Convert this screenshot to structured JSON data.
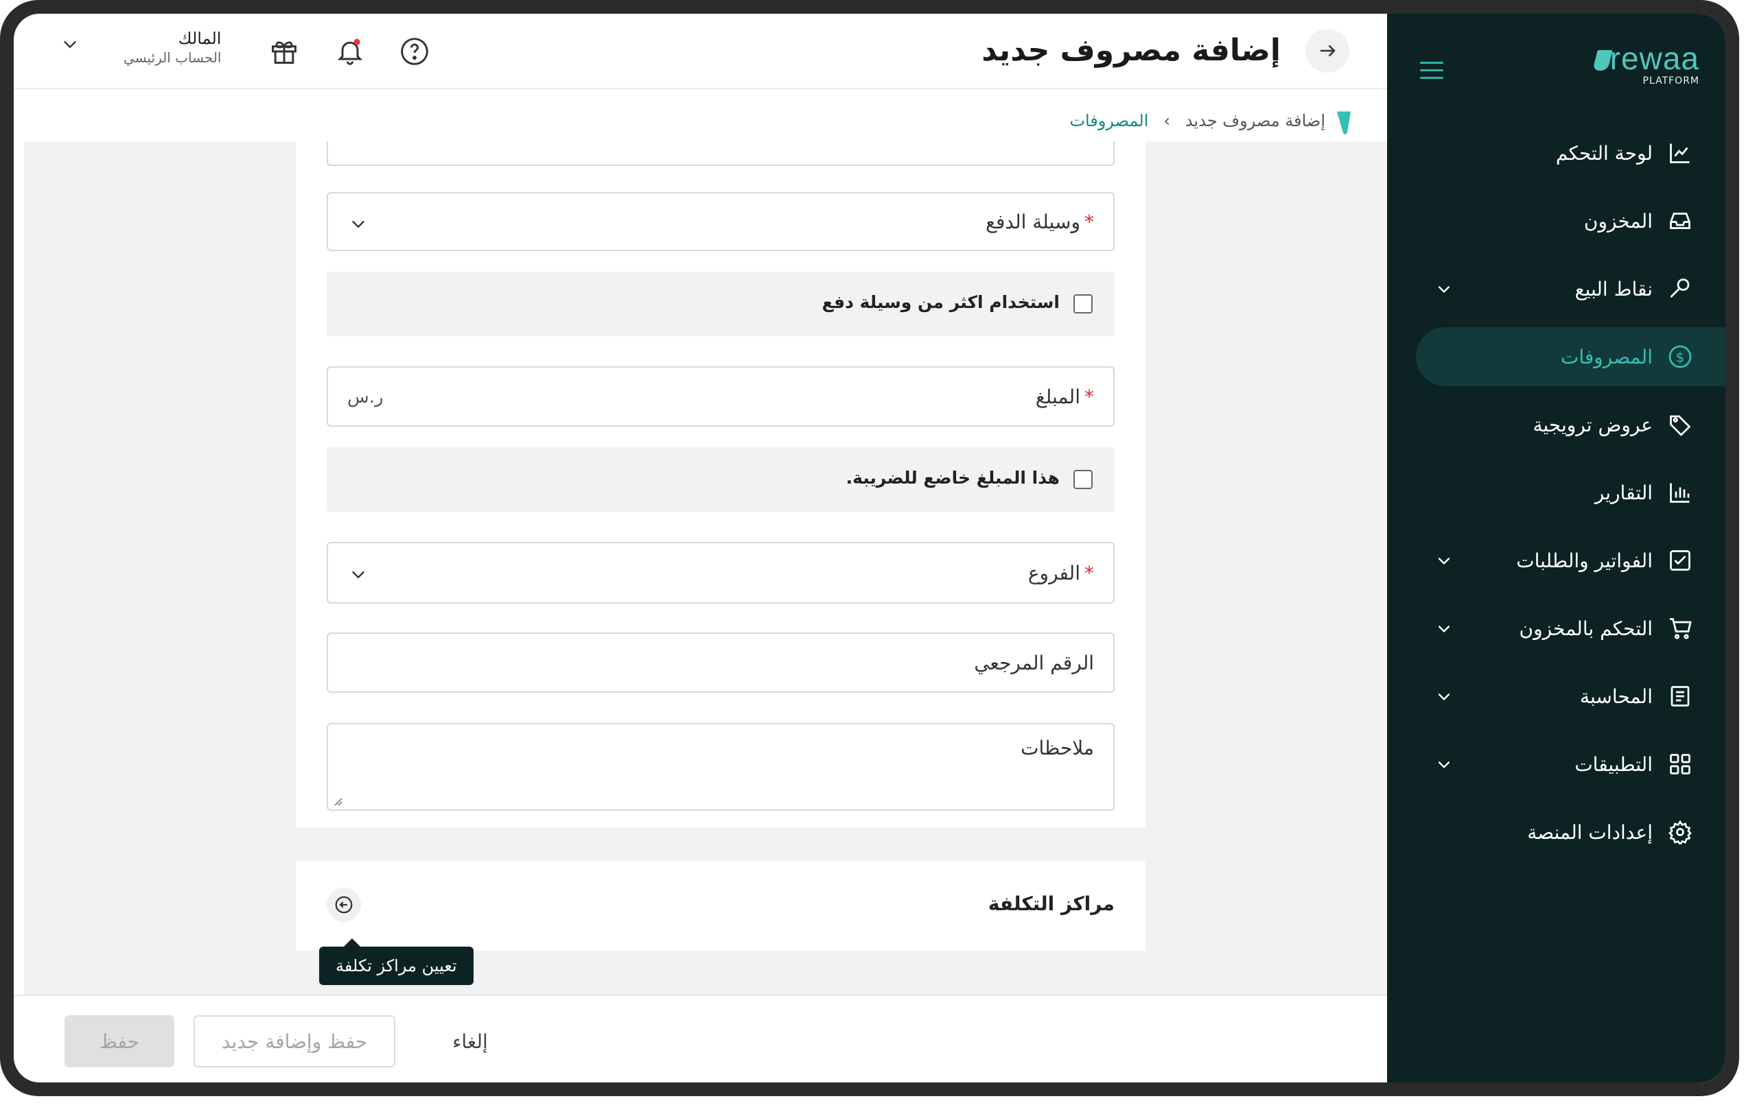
{
  "header": {
    "title": "إضافة مصروف جديد",
    "user_name": "المالك",
    "user_role": "الحساب الرئيسي"
  },
  "breadcrumb": {
    "parent": "المصروفات",
    "current": "إضافة مصروف جديد",
    "separator": "›"
  },
  "sidebar": {
    "logo_text": "rewaa",
    "logo_sub": "PLATFORM",
    "items": [
      {
        "label": "لوحة التحكم",
        "icon": "chart-line-icon",
        "expandable": false
      },
      {
        "label": "المخزون",
        "icon": "inbox-icon",
        "expandable": false
      },
      {
        "label": "نقاط البيع",
        "icon": "key-icon",
        "expandable": true
      },
      {
        "label": "المصروفات",
        "icon": "dollar-circle-icon",
        "expandable": false,
        "active": true
      },
      {
        "label": "عروض ترويجية",
        "icon": "tag-icon",
        "expandable": false
      },
      {
        "label": "التقارير",
        "icon": "bar-chart-icon",
        "expandable": false
      },
      {
        "label": "الفواتير والطلبات",
        "icon": "check-square-icon",
        "expandable": true
      },
      {
        "label": "التحكم بالمخزون",
        "icon": "cart-icon",
        "expandable": true
      },
      {
        "label": "المحاسبة",
        "icon": "book-icon",
        "expandable": true
      },
      {
        "label": "التطبيقات",
        "icon": "grid-icon",
        "expandable": true
      },
      {
        "label": "إعدادات المنصة",
        "icon": "gear-icon",
        "expandable": false
      }
    ]
  },
  "form": {
    "payment_method_label": "وسيلة الدفع",
    "multi_payment_label": "استخدام اكثر من وسيلة دفع",
    "amount_label": "المبلغ",
    "currency": "ر.س",
    "taxable_label": "هذا المبلغ خاضع للضريبة.",
    "branches_label": "الفروع",
    "reference_label": "الرقم المرجعي",
    "notes_label": "ملاحظات",
    "required_mark": "*"
  },
  "cost_centers": {
    "title": "مراكز التكلفة",
    "tooltip": "تعيين مراكز تكلفة"
  },
  "footer": {
    "save": "حفظ",
    "save_and_new": "حفظ وإضافة جديد",
    "cancel": "إلغاء"
  },
  "colors": {
    "sidebar_bg": "#0d2323",
    "accent": "#34bfb1",
    "active_bg": "#123a3a",
    "required": "#d32f2f"
  }
}
